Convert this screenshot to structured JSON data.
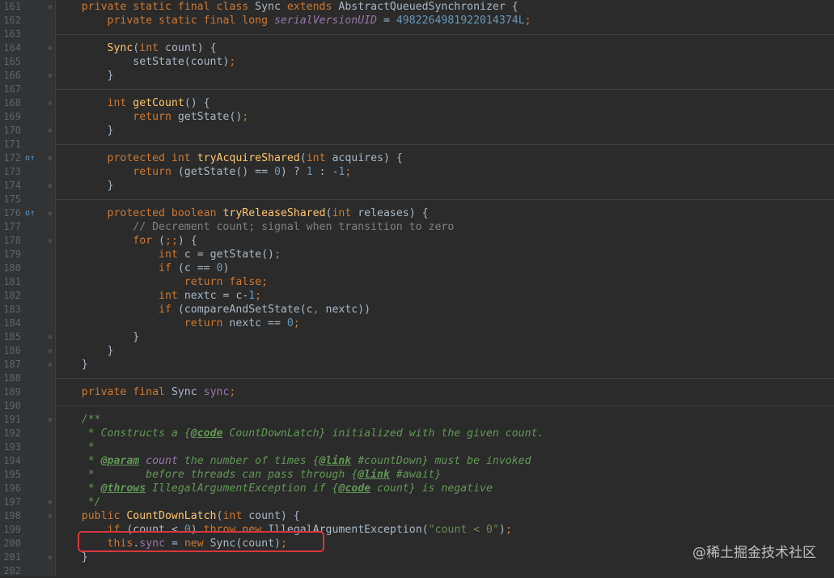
{
  "editor": {
    "lines": [
      {
        "n": "161",
        "marker": "",
        "fold": "⊖",
        "segs": [
          [
            "    ",
            ""
          ],
          [
            "private static final class ",
            "kw"
          ],
          [
            "Sync ",
            ""
          ],
          [
            "extends ",
            "kw"
          ],
          [
            "AbstractQueuedSynchronizer {",
            ""
          ]
        ]
      },
      {
        "n": "162",
        "marker": "",
        "fold": "",
        "segs": [
          [
            "        ",
            ""
          ],
          [
            "private static final long ",
            "kw"
          ],
          [
            "serialVersionUID",
            "fld ital"
          ],
          [
            " = ",
            ""
          ],
          [
            "4982264981922014374L",
            "num"
          ],
          [
            ";",
            "kw"
          ]
        ]
      },
      {
        "n": "163",
        "marker": "",
        "fold": "",
        "segs": []
      },
      {
        "n": "164",
        "marker": "",
        "fold": "⊖",
        "segs": [
          [
            "        ",
            ""
          ],
          [
            "Sync",
            "fn"
          ],
          [
            "(",
            ""
          ],
          [
            "int ",
            "kw"
          ],
          [
            "count) {",
            ""
          ]
        ]
      },
      {
        "n": "165",
        "marker": "",
        "fold": "",
        "segs": [
          [
            "            setState(count)",
            ""
          ],
          [
            ";",
            "kw"
          ]
        ]
      },
      {
        "n": "166",
        "marker": "",
        "fold": "⊖",
        "segs": [
          [
            "        }",
            ""
          ]
        ]
      },
      {
        "n": "167",
        "marker": "",
        "fold": "",
        "segs": []
      },
      {
        "n": "168",
        "marker": "",
        "fold": "⊖",
        "segs": [
          [
            "        ",
            ""
          ],
          [
            "int ",
            "kw"
          ],
          [
            "getCount",
            "fn"
          ],
          [
            "() {",
            ""
          ]
        ]
      },
      {
        "n": "169",
        "marker": "",
        "fold": "",
        "segs": [
          [
            "            ",
            ""
          ],
          [
            "return ",
            "kw"
          ],
          [
            "getState()",
            ""
          ],
          [
            ";",
            "kw"
          ]
        ]
      },
      {
        "n": "170",
        "marker": "",
        "fold": "⊖",
        "segs": [
          [
            "        }",
            ""
          ]
        ]
      },
      {
        "n": "171",
        "marker": "",
        "fold": "",
        "segs": []
      },
      {
        "n": "172",
        "marker": "o↑",
        "fold": "⊖",
        "segs": [
          [
            "        ",
            ""
          ],
          [
            "protected int ",
            "kw"
          ],
          [
            "tryAcquireShared",
            "fn"
          ],
          [
            "(",
            ""
          ],
          [
            "int ",
            "kw"
          ],
          [
            "acquires) {",
            ""
          ]
        ]
      },
      {
        "n": "173",
        "marker": "",
        "fold": "",
        "segs": [
          [
            "            ",
            ""
          ],
          [
            "return ",
            "kw"
          ],
          [
            "(getState() == ",
            ""
          ],
          [
            "0",
            "num"
          ],
          [
            ") ? ",
            ""
          ],
          [
            "1",
            "num"
          ],
          [
            " : -",
            ""
          ],
          [
            "1",
            "num"
          ],
          [
            ";",
            "kw"
          ]
        ]
      },
      {
        "n": "174",
        "marker": "",
        "fold": "⊖",
        "segs": [
          [
            "        }",
            ""
          ]
        ]
      },
      {
        "n": "175",
        "marker": "",
        "fold": "",
        "segs": []
      },
      {
        "n": "176",
        "marker": "o↑",
        "fold": "⊖",
        "segs": [
          [
            "        ",
            ""
          ],
          [
            "protected boolean ",
            "kw"
          ],
          [
            "tryReleaseShared",
            "fn"
          ],
          [
            "(",
            ""
          ],
          [
            "int ",
            "kw"
          ],
          [
            "releases) {",
            ""
          ]
        ]
      },
      {
        "n": "177",
        "marker": "",
        "fold": "",
        "segs": [
          [
            "            ",
            ""
          ],
          [
            "// Decrement count; signal when transition to zero",
            "cmt"
          ]
        ]
      },
      {
        "n": "178",
        "marker": "",
        "fold": "⊖",
        "segs": [
          [
            "            ",
            ""
          ],
          [
            "for ",
            "kw"
          ],
          [
            "(",
            ""
          ],
          [
            ";;",
            "kw"
          ],
          [
            ") {",
            ""
          ]
        ]
      },
      {
        "n": "179",
        "marker": "",
        "fold": "",
        "segs": [
          [
            "                ",
            ""
          ],
          [
            "int ",
            "kw"
          ],
          [
            "c = getState()",
            ""
          ],
          [
            ";",
            "kw"
          ]
        ]
      },
      {
        "n": "180",
        "marker": "",
        "fold": "",
        "segs": [
          [
            "                ",
            ""
          ],
          [
            "if ",
            "kw"
          ],
          [
            "(c == ",
            ""
          ],
          [
            "0",
            "num"
          ],
          [
            ")",
            ""
          ]
        ]
      },
      {
        "n": "181",
        "marker": "",
        "fold": "",
        "segs": [
          [
            "                    ",
            ""
          ],
          [
            "return false;",
            "kw"
          ]
        ]
      },
      {
        "n": "182",
        "marker": "",
        "fold": "",
        "segs": [
          [
            "                ",
            ""
          ],
          [
            "int ",
            "kw"
          ],
          [
            "nextc = c-",
            ""
          ],
          [
            "1",
            "num"
          ],
          [
            ";",
            "kw"
          ]
        ]
      },
      {
        "n": "183",
        "marker": "",
        "fold": "",
        "segs": [
          [
            "                ",
            ""
          ],
          [
            "if ",
            "kw"
          ],
          [
            "(compareAndSetState(c",
            ""
          ],
          [
            ", ",
            "kw"
          ],
          [
            "nextc))",
            ""
          ]
        ]
      },
      {
        "n": "184",
        "marker": "",
        "fold": "",
        "segs": [
          [
            "                    ",
            ""
          ],
          [
            "return ",
            "kw"
          ],
          [
            "nextc == ",
            ""
          ],
          [
            "0",
            "num"
          ],
          [
            ";",
            "kw"
          ]
        ]
      },
      {
        "n": "185",
        "marker": "",
        "fold": "⊖",
        "segs": [
          [
            "            }",
            ""
          ]
        ]
      },
      {
        "n": "186",
        "marker": "",
        "fold": "⊖",
        "segs": [
          [
            "        }",
            ""
          ]
        ]
      },
      {
        "n": "187",
        "marker": "",
        "fold": "⊖",
        "segs": [
          [
            "    }",
            ""
          ]
        ]
      },
      {
        "n": "188",
        "marker": "",
        "fold": "",
        "segs": []
      },
      {
        "n": "189",
        "marker": "",
        "fold": "",
        "segs": [
          [
            "    ",
            ""
          ],
          [
            "private final ",
            "kw"
          ],
          [
            "Sync ",
            ""
          ],
          [
            "sync",
            "fld"
          ],
          [
            ";",
            "kw"
          ]
        ]
      },
      {
        "n": "190",
        "marker": "",
        "fold": "",
        "segs": []
      },
      {
        "n": "191",
        "marker": "",
        "fold": "⊖",
        "segs": [
          [
            "    ",
            ""
          ],
          [
            "/**",
            "doc"
          ]
        ]
      },
      {
        "n": "192",
        "marker": "",
        "fold": "",
        "segs": [
          [
            "     ",
            ""
          ],
          [
            "* Constructs a {",
            "doc"
          ],
          [
            "@code",
            "doctag"
          ],
          [
            " CountDownLatch} initialized with the given count.",
            "doc"
          ]
        ]
      },
      {
        "n": "193",
        "marker": "",
        "fold": "",
        "segs": [
          [
            "     ",
            ""
          ],
          [
            "*",
            "doc"
          ]
        ]
      },
      {
        "n": "194",
        "marker": "",
        "fold": "",
        "segs": [
          [
            "     ",
            ""
          ],
          [
            "* ",
            "doc"
          ],
          [
            "@param",
            "doctag"
          ],
          [
            " count ",
            "fld ital"
          ],
          [
            "the number of times {",
            "doc"
          ],
          [
            "@link",
            "doctag"
          ],
          [
            " #countDown} must be invoked",
            "doc"
          ]
        ]
      },
      {
        "n": "195",
        "marker": "",
        "fold": "",
        "segs": [
          [
            "     ",
            ""
          ],
          [
            "*        before threads can pass through {",
            "doc"
          ],
          [
            "@link",
            "doctag"
          ],
          [
            " #await}",
            "doc"
          ]
        ]
      },
      {
        "n": "196",
        "marker": "",
        "fold": "",
        "segs": [
          [
            "     ",
            ""
          ],
          [
            "* ",
            "doc"
          ],
          [
            "@throws",
            "doctag"
          ],
          [
            " IllegalArgumentException ",
            "docref"
          ],
          [
            "if {",
            "doc"
          ],
          [
            "@code",
            "doctag"
          ],
          [
            " count} is negative",
            "doc"
          ]
        ]
      },
      {
        "n": "197",
        "marker": "",
        "fold": "⊖",
        "segs": [
          [
            "     ",
            ""
          ],
          [
            "*/",
            "doc"
          ]
        ]
      },
      {
        "n": "198",
        "marker": "",
        "fold": "⊖",
        "segs": [
          [
            "    ",
            ""
          ],
          [
            "public ",
            "kw"
          ],
          [
            "CountDownLatch",
            "fn"
          ],
          [
            "(",
            ""
          ],
          [
            "int ",
            "kw"
          ],
          [
            "count) {",
            ""
          ]
        ]
      },
      {
        "n": "199",
        "marker": "",
        "fold": "",
        "segs": [
          [
            "        ",
            ""
          ],
          [
            "if ",
            "kw"
          ],
          [
            "(count < ",
            ""
          ],
          [
            "0",
            "num"
          ],
          [
            ") ",
            ""
          ],
          [
            "throw new ",
            "kw"
          ],
          [
            "IllegalArgumentException(",
            ""
          ],
          [
            "\"count < 0\"",
            "str"
          ],
          [
            ")",
            ""
          ],
          [
            ";",
            "kw"
          ]
        ]
      },
      {
        "n": "200",
        "marker": "",
        "fold": "",
        "segs": [
          [
            "        ",
            ""
          ],
          [
            "this",
            "kw"
          ],
          [
            ".",
            ""
          ],
          [
            "sync",
            "fld"
          ],
          [
            " = ",
            ""
          ],
          [
            "new ",
            "kw"
          ],
          [
            "Sync(count)",
            ""
          ],
          [
            ";",
            "kw"
          ]
        ]
      },
      {
        "n": "201",
        "marker": "",
        "fold": "⊖",
        "segs": [
          [
            "    }",
            ""
          ]
        ]
      },
      {
        "n": "202",
        "marker": "",
        "fold": "",
        "segs": []
      }
    ]
  },
  "watermark": "@稀土掘金技术社区",
  "colors": {
    "background": "#2b2b2b",
    "keyword": "#cc7832",
    "method": "#ffc66d",
    "number": "#6897bb",
    "field": "#9876aa",
    "doc_comment": "#629755",
    "highlight_box": "#d9363e"
  }
}
